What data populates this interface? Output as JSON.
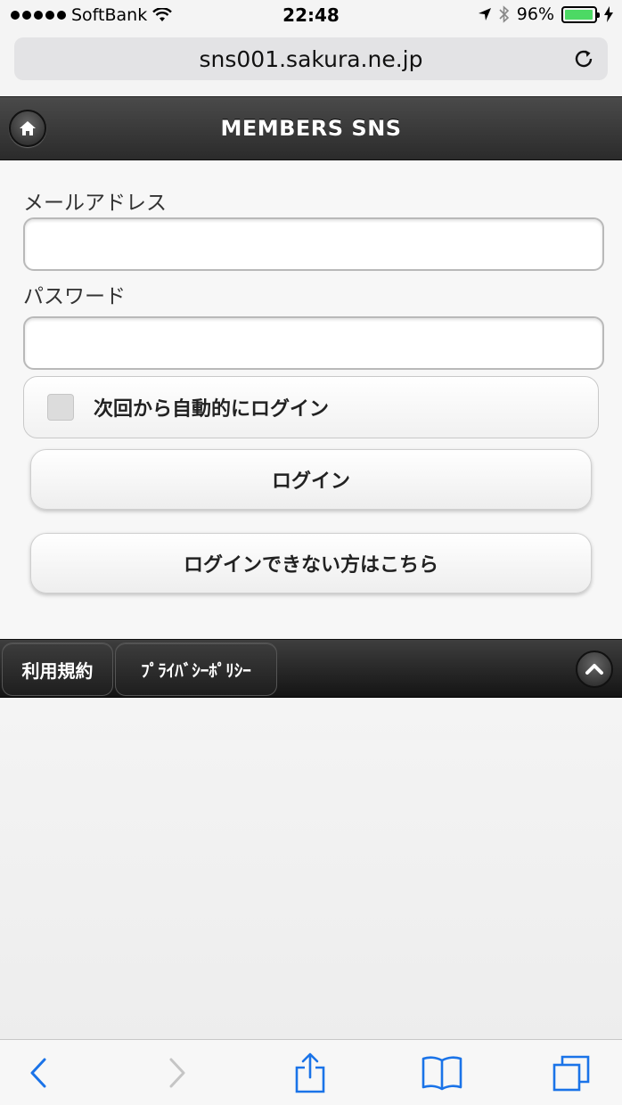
{
  "status_bar": {
    "carrier": "SoftBank",
    "time": "22:48",
    "battery_percent": "96%",
    "battery_level": 0.96,
    "battery_color": "#4cd964"
  },
  "browser": {
    "url": "sns001.sakura.ne.jp",
    "reload_icon": "reload-icon",
    "toolbar_icons": [
      "back-icon",
      "forward-icon",
      "share-icon",
      "bookmarks-icon",
      "tabs-icon"
    ],
    "accent_color": "#1a73e8"
  },
  "header": {
    "title": "MEMBERS SNS",
    "home_icon": "home-icon"
  },
  "form": {
    "email_label": "メールアドレス",
    "email_value": "",
    "password_label": "パスワード",
    "password_value": "",
    "remember_label": "次回から自動的にログイン",
    "remember_checked": false,
    "login_button": "ログイン",
    "forgot_button": "ログインできない方はこちら"
  },
  "footer": {
    "terms": "利用規約",
    "privacy": "ﾌﾟﾗｲﾊﾞｼｰﾎﾟﾘｼｰ",
    "top_icon": "chevron-up-icon"
  }
}
